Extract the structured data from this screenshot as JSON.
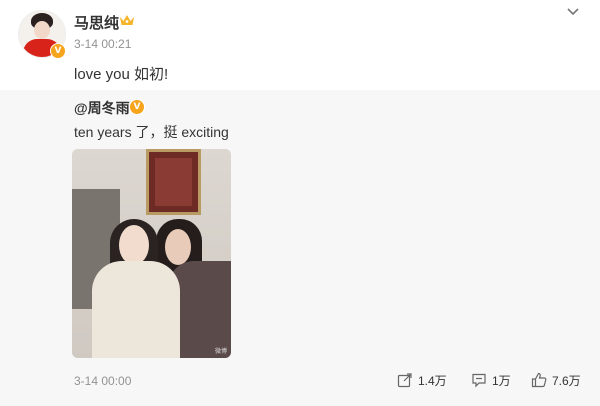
{
  "post": {
    "author": "马思纯",
    "time": "3-14 00:21",
    "text": "love you 如初!",
    "verified_badge": "V",
    "icons": [
      "crown-icon",
      "chevron-down-icon"
    ]
  },
  "repost": {
    "author": "@周冬雨",
    "verified_badge": "V",
    "text": "ten years 了，挺 exciting",
    "photo_watermark": "微博",
    "time": "3-14 00:00",
    "actions": {
      "share_count": "1.4万",
      "comment_count": "1万",
      "like_count": "7.6万"
    }
  },
  "colors": {
    "badge": "#f6a41c",
    "muted_text": "#939393",
    "repost_bg": "#f7f7f7"
  }
}
